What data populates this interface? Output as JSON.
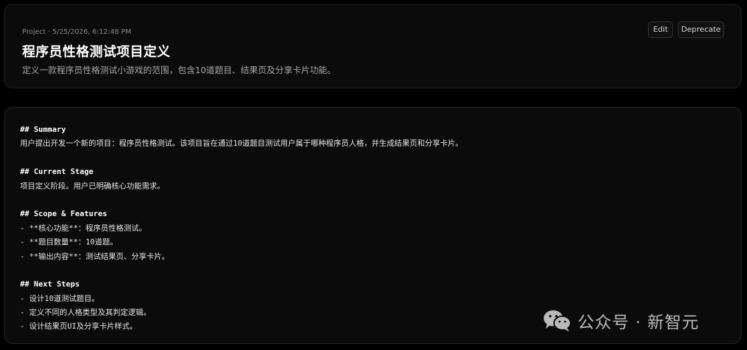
{
  "header": {
    "meta": "Project · 5/25/2026, 6:12:48 PM",
    "title": "程序员性格测试项目定义",
    "subtitle": "定义一款程序员性格测试小游戏的范围，包含10道题目、结果页及分享卡片功能。",
    "edit_label": "Edit",
    "deprecate_label": "Deprecate"
  },
  "document": {
    "summary_heading": "## Summary",
    "summary_text": "用户提出开发一个新的项目：程序员性格测试。该项目旨在通过10道题目测试用户属于哪种程序员人格，并生成结果页和分享卡片。",
    "stage_heading": "## Current Stage",
    "stage_text": "项目定义阶段。用户已明确核心功能需求。",
    "scope_heading": "## Scope & Features",
    "scope_items": [
      "- **核心功能**：程序员性格测试。",
      "- **题目数量**：10道题。",
      "- **输出内容**：测试结果页、分享卡片。"
    ],
    "next_heading": "## Next Steps",
    "next_items": [
      "- 设计10道测试题目。",
      "- 定义不同的人格类型及其判定逻辑。",
      "- 设计结果页UI及分享卡片样式。"
    ]
  },
  "watermark": {
    "text": "公众号 · 新智元",
    "icon": "wechat-icon"
  }
}
